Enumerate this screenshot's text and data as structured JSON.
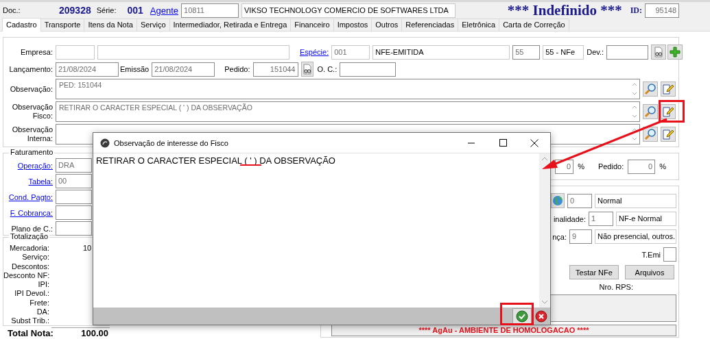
{
  "header": {
    "doc_label": "Doc.:",
    "doc_number": "209328",
    "serie_label": "Série:",
    "serie": "001",
    "agent_link": "Agente",
    "agent_code": "10811",
    "agent_name": "VIKSO TECHNOLOGY COMERCIO DE SOFTWARES LTDA",
    "status": "*** Indefinido ***",
    "id_label": "ID:",
    "id": "95148"
  },
  "tabs": [
    {
      "label": "Cadastro",
      "selected": true
    },
    {
      "label": "Transporte",
      "selected": false
    },
    {
      "label": "Itens da Nota",
      "selected": false
    },
    {
      "label": "Serviço",
      "selected": false
    },
    {
      "label": "Intermediador, Retirada e Entrega",
      "selected": false
    },
    {
      "label": "Financeiro",
      "selected": false
    },
    {
      "label": "Impostos",
      "selected": false
    },
    {
      "label": "Outros",
      "selected": false
    },
    {
      "label": "Referenciadas",
      "selected": false
    },
    {
      "label": "Eletrônica",
      "selected": false
    },
    {
      "label": "Carta de Correção",
      "selected": false
    }
  ],
  "cadastro": {
    "empresa_label": "Empresa:",
    "especie_link": "Espécie:",
    "especie_code": "001",
    "especie_name": "NFE-EMITIDA",
    "model_code": "55",
    "model_name": "55 - NFe",
    "dev_label": "Dev.:",
    "lancamento_label": "Lançamento:",
    "lancamento": "21/08/2024",
    "emissao_label": "Emissão",
    "emissao": "21/08/2024",
    "pedido_label": "Pedido:",
    "pedido": "151044",
    "oc_label": "O. C.:",
    "notes": [
      {
        "label": "Observação:",
        "value": "PED: 151044"
      },
      {
        "label": "Observação Fisco:",
        "value": "RETIRAR O CARACTER ESPECIAL ( ' ) DA OBSERVAÇÃO"
      },
      {
        "label": "Observação Interna:"
      }
    ]
  },
  "faturamento": {
    "title": "Faturamento",
    "fields": [
      {
        "kind": "link",
        "label": "Operação:",
        "value": "DRA"
      },
      {
        "kind": "link",
        "label": "Tabela:",
        "value": "00"
      },
      {
        "kind": "link",
        "label": "Cond. Pagto:"
      },
      {
        "kind": "link",
        "label": "F. Cobrança:"
      },
      {
        "kind": "label",
        "label": "Plano de C.:"
      }
    ]
  },
  "totalizacao": {
    "title": "Totalização",
    "rows": [
      {
        "label": "Mercadoria:",
        "value": "10"
      },
      {
        "label": "Serviço:"
      },
      {
        "label": "Descontos:"
      },
      {
        "label": "Desconto NF:"
      },
      {
        "label": "IPI:"
      },
      {
        "label": "IPI Devol.:"
      },
      {
        "label": "Frete:"
      },
      {
        "label": "DA:"
      },
      {
        "label": "Subst Trib.:"
      }
    ],
    "total_label": "Total Nota:",
    "total": "100.00"
  },
  "comissao": {
    "value": "0",
    "unit": "%",
    "pedido_label": "Pedido:",
    "pedido": "0",
    "pedido_unit": "%"
  },
  "nfe": {
    "tipo_code": "0",
    "tipo_name": "Normal",
    "finalidade_label": "inalidade:",
    "finalidade_code": "1",
    "finalidade_name": "NF-e Normal",
    "presenca_label": "nça:",
    "presenca_code": "9",
    "presenca_name": "Não presencial, outros.",
    "temi_label": "T.Emi",
    "buttons": [
      "Testar NFe",
      "Arquivos"
    ],
    "rps_label": "Nro. RPS:",
    "environment": "**** AgAu - AMBIENTE DE HOMOLOGACAO ****"
  },
  "dialog": {
    "title": "Observação de interesse do Fisco",
    "text": "RETIRAR O CARACTER ESPECIAL ( ' ) DA OBSERVAÇÃO"
  }
}
